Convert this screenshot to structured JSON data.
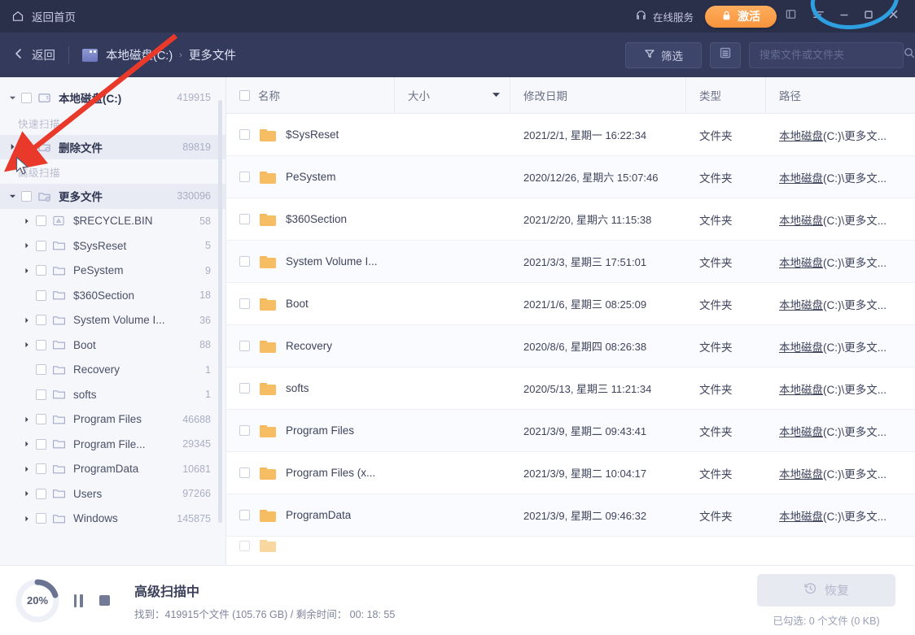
{
  "titlebar": {
    "home_label": "返回首页",
    "service_label": "在线服务",
    "activate_label": "激活",
    "home_icon": "home-icon",
    "service_icon": "headset-icon",
    "lock_icon": "lock-icon",
    "sidebar_toggle_icon": "panel-icon",
    "menu_icon": "menu-icon",
    "minimize_icon": "minimize-icon",
    "maximize_icon": "maximize-icon",
    "close_icon": "close-icon"
  },
  "navbar": {
    "back_label": "返回",
    "breadcrumb": [
      "本地磁盘(C:)",
      "更多文件"
    ],
    "breadcrumb_sep": "›",
    "filter_label": "筛选",
    "filter_icon": "funnel-icon",
    "view_icon": "list-view-icon",
    "search_placeholder": "搜索文件或文件夹",
    "search_value": "",
    "search_icon": "search-icon"
  },
  "sidebar": {
    "root": {
      "label": "本地磁盘(C:)",
      "count": "419915",
      "icon": "drive-icon"
    },
    "groups": [
      {
        "title": "快速扫描",
        "items": [
          {
            "label": "删除文件",
            "count": "89819",
            "icon": "folder-deleted-icon",
            "level": 1,
            "expandable": true,
            "expanded": false,
            "selected": true,
            "bold": true
          }
        ]
      },
      {
        "title": "高级扫描",
        "items": [
          {
            "label": "更多文件",
            "count": "330096",
            "icon": "folder-more-icon",
            "level": 1,
            "expandable": true,
            "expanded": true,
            "selected": true,
            "bold": true
          },
          {
            "label": "$RECYCLE.BIN",
            "count": "58",
            "icon": "recycle-icon",
            "level": 2,
            "expandable": true,
            "expanded": false,
            "selected": false,
            "bold": false
          },
          {
            "label": "$SysReset",
            "count": "5",
            "icon": "folder-icon",
            "level": 2,
            "expandable": true,
            "expanded": false,
            "selected": false,
            "bold": false
          },
          {
            "label": "PeSystem",
            "count": "9",
            "icon": "folder-icon",
            "level": 2,
            "expandable": true,
            "expanded": false,
            "selected": false,
            "bold": false
          },
          {
            "label": "$360Section",
            "count": "18",
            "icon": "folder-icon",
            "level": 2,
            "expandable": false,
            "expanded": false,
            "selected": false,
            "bold": false
          },
          {
            "label": "System Volume I...",
            "count": "36",
            "icon": "folder-icon",
            "level": 2,
            "expandable": true,
            "expanded": false,
            "selected": false,
            "bold": false
          },
          {
            "label": "Boot",
            "count": "88",
            "icon": "folder-icon",
            "level": 2,
            "expandable": true,
            "expanded": false,
            "selected": false,
            "bold": false
          },
          {
            "label": "Recovery",
            "count": "1",
            "icon": "folder-icon",
            "level": 2,
            "expandable": false,
            "expanded": false,
            "selected": false,
            "bold": false
          },
          {
            "label": "softs",
            "count": "1",
            "icon": "folder-icon",
            "level": 2,
            "expandable": false,
            "expanded": false,
            "selected": false,
            "bold": false
          },
          {
            "label": "Program Files",
            "count": "46688",
            "icon": "folder-icon",
            "level": 2,
            "expandable": true,
            "expanded": false,
            "selected": false,
            "bold": false
          },
          {
            "label": "Program File...",
            "count": "29345",
            "icon": "folder-icon",
            "level": 2,
            "expandable": true,
            "expanded": false,
            "selected": false,
            "bold": false
          },
          {
            "label": "ProgramData",
            "count": "10681",
            "icon": "folder-icon",
            "level": 2,
            "expandable": true,
            "expanded": false,
            "selected": false,
            "bold": false
          },
          {
            "label": "Users",
            "count": "97266",
            "icon": "folder-icon",
            "level": 2,
            "expandable": true,
            "expanded": false,
            "selected": false,
            "bold": false
          },
          {
            "label": "Windows",
            "count": "145875",
            "icon": "folder-icon",
            "level": 2,
            "expandable": true,
            "expanded": false,
            "selected": false,
            "bold": false
          }
        ]
      }
    ]
  },
  "table": {
    "columns": [
      {
        "key": "name",
        "label": "名称",
        "has_checkbox": true
      },
      {
        "key": "size",
        "label": "大小",
        "sort": "desc"
      },
      {
        "key": "date",
        "label": "修改日期"
      },
      {
        "key": "type",
        "label": "类型"
      },
      {
        "key": "path",
        "label": "路径"
      }
    ],
    "rows": [
      {
        "name": "$SysReset",
        "size": "",
        "date": "2021/2/1, 星期一 16:22:34",
        "type": "文件夹",
        "path_drive": "本地磁盘",
        "path_rest": "(C:)\\更多文..."
      },
      {
        "name": "PeSystem",
        "size": "",
        "date": "2020/12/26, 星期六 15:07:46",
        "type": "文件夹",
        "path_drive": "本地磁盘",
        "path_rest": "(C:)\\更多文..."
      },
      {
        "name": "$360Section",
        "size": "",
        "date": "2021/2/20, 星期六 11:15:38",
        "type": "文件夹",
        "path_drive": "本地磁盘",
        "path_rest": "(C:)\\更多文..."
      },
      {
        "name": "System Volume I...",
        "size": "",
        "date": "2021/3/3, 星期三 17:51:01",
        "type": "文件夹",
        "path_drive": "本地磁盘",
        "path_rest": "(C:)\\更多文..."
      },
      {
        "name": "Boot",
        "size": "",
        "date": "2021/1/6, 星期三 08:25:09",
        "type": "文件夹",
        "path_drive": "本地磁盘",
        "path_rest": "(C:)\\更多文..."
      },
      {
        "name": "Recovery",
        "size": "",
        "date": "2020/8/6, 星期四 08:26:38",
        "type": "文件夹",
        "path_drive": "本地磁盘",
        "path_rest": "(C:)\\更多文..."
      },
      {
        "name": "softs",
        "size": "",
        "date": "2020/5/13, 星期三 11:21:34",
        "type": "文件夹",
        "path_drive": "本地磁盘",
        "path_rest": "(C:)\\更多文..."
      },
      {
        "name": "Program Files",
        "size": "",
        "date": "2021/3/9, 星期二 09:43:41",
        "type": "文件夹",
        "path_drive": "本地磁盘",
        "path_rest": "(C:)\\更多文..."
      },
      {
        "name": "Program Files (x...",
        "size": "",
        "date": "2021/3/9, 星期二 10:04:17",
        "type": "文件夹",
        "path_drive": "本地磁盘",
        "path_rest": "(C:)\\更多文..."
      },
      {
        "name": "ProgramData",
        "size": "",
        "date": "2021/3/9, 星期二 09:46:32",
        "type": "文件夹",
        "path_drive": "本地磁盘",
        "path_rest": "(C:)\\更多文..."
      }
    ]
  },
  "footer": {
    "progress_percent": "20%",
    "progress_value": 20,
    "pause_icon": "pause-icon",
    "stop_icon": "stop-icon",
    "status_title": "高级扫描中",
    "status_sub": "找到：419915个文件 (105.76 GB) / 剩余时间： 00: 18: 55",
    "restore_label": "恢复",
    "restore_icon": "restore-clock-icon",
    "selected_info": "已勾选: 0 个文件 (0 KB)"
  },
  "colors": {
    "titlebar_bg": "#2a2f4a",
    "navbar_bg": "#343a5c",
    "accent_orange": "#f8943c",
    "folder_yellow": "#f6bd63",
    "annotation_red": "#e8392a",
    "annotation_blue": "#2e9fe0"
  }
}
